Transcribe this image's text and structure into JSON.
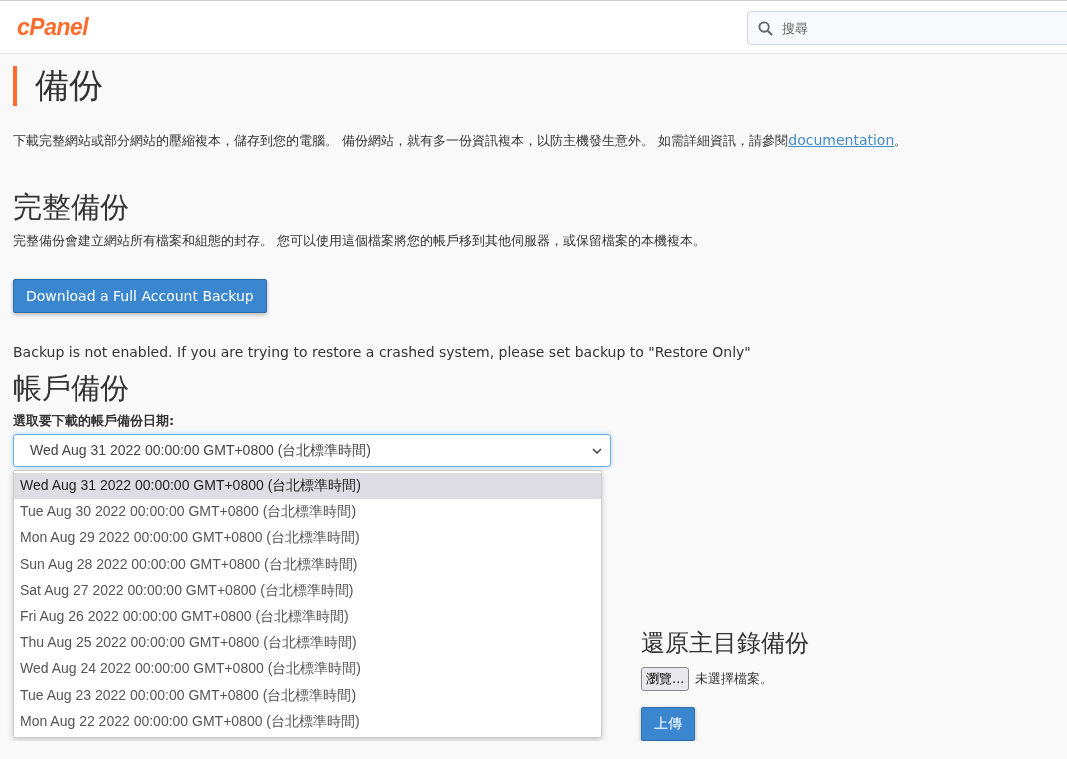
{
  "header": {
    "logo": "cPanel",
    "search": {
      "placeholder": "搜尋"
    }
  },
  "page": {
    "title": "備份",
    "intro": "下載完整網站或部分網站的壓縮複本，儲存到您的電腦。 備份網站，就有多一份資訊複本，以防主機發生意外。 如需詳細資訊，請參閱",
    "intro_link": "documentation",
    "intro_end": "。"
  },
  "full_backup": {
    "title": "完整備份",
    "description": "完整備份會建立網站所有檔案和組態的封存。 您可以使用這個檔案將您的帳戶移到其他伺服器，或保留檔案的本機複本。",
    "button": "Download a Full Account Backup"
  },
  "notice": "Backup is not enabled. If you are trying to restore a crashed system, please set backup to \"Restore Only\"",
  "account_backup": {
    "title": "帳戶備份",
    "label": "選取要下載的帳戶備份日期:",
    "select": {
      "value": "Wed Aug 31 2022 00:00:00 GMT+0800 (台北標準時間)",
      "expanded": true,
      "options": [
        {
          "label": "Wed Aug 31 2022 00:00:00 GMT+0800 (台北標準時間)",
          "selected": true
        },
        {
          "label": "Tue Aug 30 2022 00:00:00 GMT+0800 (台北標準時間)",
          "selected": false
        },
        {
          "label": "Mon Aug 29 2022 00:00:00 GMT+0800 (台北標準時間)",
          "selected": false
        },
        {
          "label": "Sun Aug 28 2022 00:00:00 GMT+0800 (台北標準時間)",
          "selected": false
        },
        {
          "label": "Sat Aug 27 2022 00:00:00 GMT+0800 (台北標準時間)",
          "selected": false
        },
        {
          "label": "Fri Aug 26 2022 00:00:00 GMT+0800 (台北標準時間)",
          "selected": false
        },
        {
          "label": "Thu Aug 25 2022 00:00:00 GMT+0800 (台北標準時間)",
          "selected": false
        },
        {
          "label": "Wed Aug 24 2022 00:00:00 GMT+0800 (台北標準時間)",
          "selected": false
        },
        {
          "label": "Tue Aug 23 2022 00:00:00 GMT+0800 (台北標準時間)",
          "selected": false
        },
        {
          "label": "Mon Aug 22 2022 00:00:00 GMT+0800 (台北標準時間)",
          "selected": false
        }
      ]
    }
  },
  "restore": {
    "title": "還原主目錄備份",
    "browse_button": "瀏覽...",
    "file_status": "未選擇檔案。",
    "upload_button": "上傳"
  }
}
